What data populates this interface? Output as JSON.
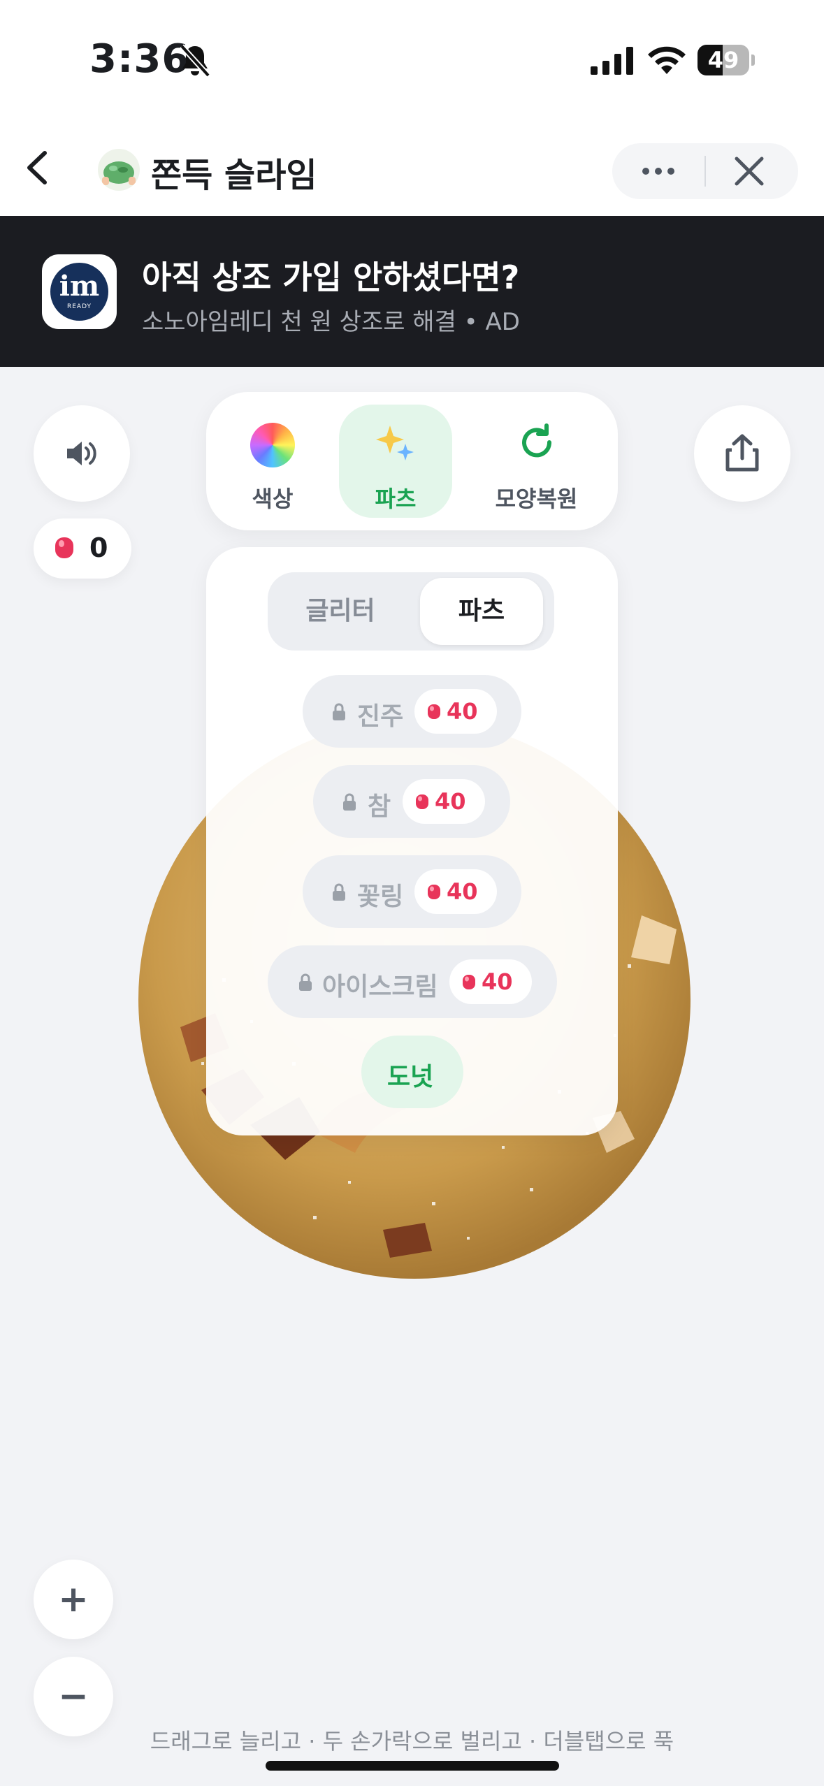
{
  "status_bar": {
    "time": "3:36",
    "battery_level": "49",
    "battery_fraction": 0.49
  },
  "nav": {
    "title": "쫀득 슬라임"
  },
  "ad": {
    "logo_text": "im",
    "logo_subtext": "READY",
    "title": "아직 상조 가입 안하셨다면?",
    "subtitle": "소노아임레디 천 원 상조로 해결 • AD"
  },
  "gems": {
    "count": "0",
    "color": "#e8345a"
  },
  "toolbar": {
    "color_label": "색상",
    "parts_label": "파츠",
    "reset_label": "모양복원",
    "active": "parts"
  },
  "panel": {
    "tabs": [
      {
        "label": "글리터",
        "selected": false
      },
      {
        "label": "파츠",
        "selected": true
      }
    ],
    "parts": [
      {
        "name": "진주",
        "locked": true,
        "price": "40"
      },
      {
        "name": "참",
        "locked": true,
        "price": "40"
      },
      {
        "name": "꽃링",
        "locked": true,
        "price": "40"
      },
      {
        "name": "아이스크림",
        "locked": true,
        "price": "40"
      },
      {
        "name": "도넛",
        "locked": false,
        "selected": true
      }
    ]
  },
  "zoom": {
    "in_label": "+",
    "out_label": "−"
  },
  "hint": "드래그로 늘리고 · 두 손가락으로 벌리고 · 더블탭으로 푹",
  "icons": [
    "bell-slash-icon",
    "signal-icon",
    "wifi-icon",
    "back-icon",
    "more-icon",
    "close-icon",
    "speaker-icon",
    "gem-icon",
    "share-icon",
    "color-wheel-icon",
    "sparkle-icon",
    "refresh-icon",
    "lock-icon"
  ],
  "colors": {
    "accent_green": "#1aa352",
    "accent_green_bg": "#e3f6ea",
    "ad_bg": "#1b1c21",
    "price_red": "#e8345a"
  }
}
